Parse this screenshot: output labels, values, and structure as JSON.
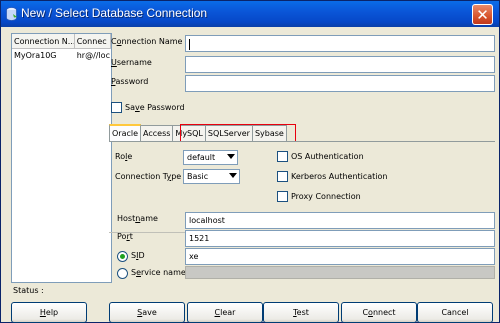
{
  "window": {
    "title": "New / Select Database Connection",
    "close_glyph": "✕"
  },
  "connections": {
    "headers": [
      "Connection N...",
      "Connec"
    ],
    "rows": [
      {
        "name": "MyOra10G",
        "conn": "hr@//loc"
      }
    ]
  },
  "form": {
    "conn_name": {
      "label_u": "o",
      "label_pre": "C",
      "label_post": "nnection Name",
      "value": ""
    },
    "username": {
      "label_u": "U",
      "label_rest": "sername",
      "value": ""
    },
    "password": {
      "label_u": "P",
      "label_rest": "assword",
      "value": ""
    },
    "save_password": {
      "label_pre": "Sa",
      "label_u": "v",
      "label_post": "e Password",
      "checked": false
    }
  },
  "tabs": [
    "Oracle",
    "Access",
    "MySQL",
    "SQLServer",
    "Sybase"
  ],
  "oracle": {
    "role": {
      "label_pre": "Ro",
      "label_u": "l",
      "label_post": "e",
      "value": "default"
    },
    "conn_type": {
      "label_pre": "Connection T",
      "label_u": "y",
      "label_post": "pe",
      "value": "Basic"
    },
    "os_auth": "OS Authentication",
    "kerberos_auth": "Kerberos Authentication",
    "proxy_conn": "Proxy Connection",
    "hostname": {
      "label_pre": "Host",
      "label_u": "n",
      "label_post": "ame",
      "value": "localhost"
    },
    "port": {
      "label_pre": "Po",
      "label_u": "r",
      "label_post": "t",
      "value": "1521"
    },
    "sid": {
      "label_pre": "S",
      "label_u": "I",
      "label_post": "D",
      "value": "xe",
      "selected": true
    },
    "service_name": {
      "label_pre": "S",
      "label_u": "e",
      "label_post": "rvice name",
      "value": ""
    }
  },
  "status": {
    "label": "Status :"
  },
  "buttons": {
    "help": {
      "u": "H",
      "rest": "elp"
    },
    "save": {
      "u": "S",
      "rest": "ave"
    },
    "clear": {
      "u": "C",
      "rest": "lear"
    },
    "test": {
      "u": "T",
      "rest": "est"
    },
    "connect": {
      "pre": "C",
      "u": "o",
      "post": "nnect"
    },
    "cancel": {
      "label": "Cancel"
    }
  }
}
